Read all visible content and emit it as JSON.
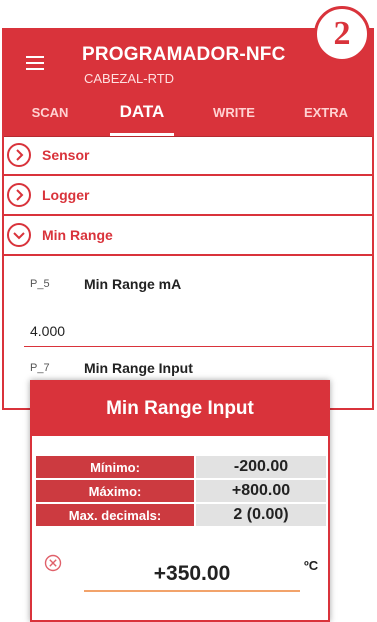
{
  "step_badge": "2",
  "app": {
    "title": "PROGRAMADOR-NFC",
    "subtitle": "CABEZAL-RTD",
    "menu_icon": "hamburger-menu-icon"
  },
  "tabs": [
    {
      "label": "SCAN",
      "active": false
    },
    {
      "label": "DATA",
      "active": true
    },
    {
      "label": "WRITE",
      "active": false
    },
    {
      "label": "EXTRA",
      "active": false
    }
  ],
  "sections": [
    {
      "label": "Sensor",
      "icon": "chevron-right-icon",
      "expanded": false
    },
    {
      "label": "Logger",
      "icon": "chevron-right-icon",
      "expanded": false
    },
    {
      "label": "Min Range",
      "icon": "chevron-down-icon",
      "expanded": true
    }
  ],
  "params": [
    {
      "code": "P_5",
      "name": "Min Range mA",
      "value": "4.000"
    },
    {
      "code": "P_7",
      "name": "Min Range Input"
    }
  ],
  "dialog": {
    "title": "Min Range Input",
    "limits": [
      {
        "label": "Mínimo:",
        "value": "-200.00"
      },
      {
        "label": "Máximo:",
        "value": "+800.00"
      },
      {
        "label": "Max. decimals:",
        "value": "2  (0.00)"
      }
    ],
    "clear_icon": "clear-circle-x-icon",
    "input_value": "+350.00",
    "unit": "ºC"
  },
  "colors": {
    "accent": "#d9333b",
    "input_underline": "#f2a36b",
    "value_bg": "#e2e2e2"
  }
}
